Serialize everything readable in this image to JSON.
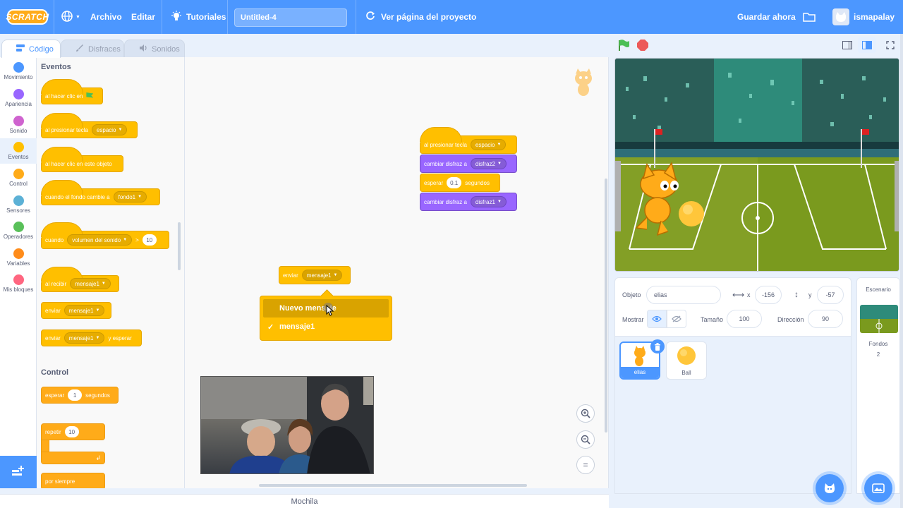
{
  "menubar": {
    "logo": "SCRATCH",
    "file": "Archivo",
    "edit": "Editar",
    "tutorials": "Tutoriales",
    "project_title": "Untitled-4",
    "see_project": "Ver página del proyecto",
    "save_now": "Guardar ahora",
    "username": "ismapalay"
  },
  "tabs": {
    "code": "Código",
    "costumes": "Disfraces",
    "sounds": "Sonidos"
  },
  "categories": [
    {
      "label": "Movimiento",
      "color": "#4c97ff"
    },
    {
      "label": "Apariencia",
      "color": "#9966ff"
    },
    {
      "label": "Sonido",
      "color": "#cf63cf"
    },
    {
      "label": "Eventos",
      "color": "#ffbf00"
    },
    {
      "label": "Control",
      "color": "#ffab19"
    },
    {
      "label": "Sensores",
      "color": "#5cb1d6"
    },
    {
      "label": "Operadores",
      "color": "#59c059"
    },
    {
      "label": "Variables",
      "color": "#ff8c1a"
    },
    {
      "label": "Mis bloques",
      "color": "#ff6680"
    }
  ],
  "palette": {
    "events_heading": "Eventos",
    "when_flag": "al hacer clic en",
    "when_key_pressed": "al presionar tecla",
    "key_space": "espacio",
    "when_sprite_clicked": "al hacer clic en este objeto",
    "when_backdrop": "cuando el fondo cambie a",
    "backdrop1": "fondo1",
    "when_loudness": "cuando",
    "loudness": "volumen del sonido",
    "gt": ">",
    "loudness_value": "10",
    "when_receive": "al recibir",
    "message1": "mensaje1",
    "broadcast": "enviar",
    "and_wait": "y esperar",
    "control_heading": "Control",
    "wait": "esperar",
    "wait_value": "1",
    "seconds": "segundos",
    "repeat": "repetir",
    "repeat_value": "10",
    "forever": "por siempre"
  },
  "script": {
    "hat_label": "al presionar tecla",
    "hat_key": "espacio",
    "switch_costume": "cambiar disfraz a",
    "costume2": "disfraz2",
    "wait": "esperar",
    "wait_value": "0.1",
    "seconds": "segundos",
    "costume1": "disfraz1",
    "broadcast": "enviar",
    "broadcast_msg": "mensaje1"
  },
  "dropdown": {
    "options": [
      {
        "label": "Nuevo mensaje",
        "checked": false
      },
      {
        "label": "mensaje1",
        "checked": true
      }
    ]
  },
  "zoom": {
    "zoom_in": "+",
    "zoom_out": "−",
    "reset": "="
  },
  "backpack": "Mochila",
  "sprite_info": {
    "sprite_label": "Objeto",
    "sprite_name": "elias",
    "x_label": "x",
    "x_value": "-156",
    "y_label": "y",
    "y_value": "-57",
    "show_label": "Mostrar",
    "size_label": "Tamaño",
    "size_value": "100",
    "direction_label": "Dirección",
    "direction_value": "90"
  },
  "sprites": [
    {
      "name": "elias",
      "selected": true
    },
    {
      "name": "Ball",
      "selected": false
    }
  ],
  "stage_panel": {
    "title": "Escenario",
    "backdrops_label": "Fondos",
    "backdrops_count": "2"
  }
}
